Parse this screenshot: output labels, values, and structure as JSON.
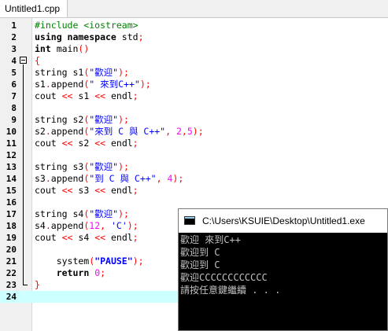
{
  "tab": {
    "label": "Untitled1.cpp"
  },
  "editor": {
    "lines": [
      {
        "num": "1",
        "tokens": [
          {
            "t": "#include <iostream>",
            "c": "pp"
          }
        ]
      },
      {
        "num": "2",
        "tokens": [
          {
            "t": "using namespace",
            "c": "kw"
          },
          {
            "t": " std",
            "c": ""
          },
          {
            "t": ";",
            "c": "sym"
          }
        ]
      },
      {
        "num": "3",
        "tokens": [
          {
            "t": "int",
            "c": "kw"
          },
          {
            "t": " main",
            "c": ""
          },
          {
            "t": "()",
            "c": "sym"
          }
        ]
      },
      {
        "num": "4",
        "tokens": [
          {
            "t": "{",
            "c": "sym"
          }
        ]
      },
      {
        "num": "5",
        "tokens": [
          {
            "t": "string s1",
            "c": ""
          },
          {
            "t": "(",
            "c": "sym"
          },
          {
            "t": "\"歡迎\"",
            "c": "str"
          },
          {
            "t": ");",
            "c": "sym"
          }
        ]
      },
      {
        "num": "6",
        "tokens": [
          {
            "t": "s1",
            "c": ""
          },
          {
            "t": ".",
            "c": "sym"
          },
          {
            "t": "append",
            "c": ""
          },
          {
            "t": "(",
            "c": "sym"
          },
          {
            "t": "\" 來到C++\"",
            "c": "str"
          },
          {
            "t": ");",
            "c": "sym"
          }
        ]
      },
      {
        "num": "7",
        "tokens": [
          {
            "t": "cout ",
            "c": ""
          },
          {
            "t": "<<",
            "c": "sym"
          },
          {
            "t": " s1 ",
            "c": ""
          },
          {
            "t": "<<",
            "c": "sym"
          },
          {
            "t": " endl",
            "c": ""
          },
          {
            "t": ";",
            "c": "sym"
          }
        ]
      },
      {
        "num": "8",
        "tokens": []
      },
      {
        "num": "9",
        "tokens": [
          {
            "t": "string s2",
            "c": ""
          },
          {
            "t": "(",
            "c": "sym"
          },
          {
            "t": "\"歡迎\"",
            "c": "str"
          },
          {
            "t": ");",
            "c": "sym"
          }
        ]
      },
      {
        "num": "10",
        "tokens": [
          {
            "t": "s2",
            "c": ""
          },
          {
            "t": ".",
            "c": "sym"
          },
          {
            "t": "append",
            "c": ""
          },
          {
            "t": "(",
            "c": "sym"
          },
          {
            "t": "\"來到 C 與 C++\"",
            "c": "str"
          },
          {
            "t": ", ",
            "c": "sym"
          },
          {
            "t": "2",
            "c": "num"
          },
          {
            "t": ",",
            "c": "sym"
          },
          {
            "t": "5",
            "c": "num"
          },
          {
            "t": ");",
            "c": "sym"
          }
        ]
      },
      {
        "num": "11",
        "tokens": [
          {
            "t": "cout ",
            "c": ""
          },
          {
            "t": "<<",
            "c": "sym"
          },
          {
            "t": " s2 ",
            "c": ""
          },
          {
            "t": "<<",
            "c": "sym"
          },
          {
            "t": " endl",
            "c": ""
          },
          {
            "t": ";",
            "c": "sym"
          }
        ]
      },
      {
        "num": "12",
        "tokens": []
      },
      {
        "num": "13",
        "tokens": [
          {
            "t": "string s3",
            "c": ""
          },
          {
            "t": "(",
            "c": "sym"
          },
          {
            "t": "\"歡迎\"",
            "c": "str"
          },
          {
            "t": ");",
            "c": "sym"
          }
        ]
      },
      {
        "num": "14",
        "tokens": [
          {
            "t": "s3",
            "c": ""
          },
          {
            "t": ".",
            "c": "sym"
          },
          {
            "t": "append",
            "c": ""
          },
          {
            "t": "(",
            "c": "sym"
          },
          {
            "t": "\"到 C 與 C++\"",
            "c": "str"
          },
          {
            "t": ", ",
            "c": "sym"
          },
          {
            "t": "4",
            "c": "num"
          },
          {
            "t": ");",
            "c": "sym"
          }
        ]
      },
      {
        "num": "15",
        "tokens": [
          {
            "t": "cout ",
            "c": ""
          },
          {
            "t": "<<",
            "c": "sym"
          },
          {
            "t": " s3 ",
            "c": ""
          },
          {
            "t": "<<",
            "c": "sym"
          },
          {
            "t": " endl",
            "c": ""
          },
          {
            "t": ";",
            "c": "sym"
          }
        ]
      },
      {
        "num": "16",
        "tokens": []
      },
      {
        "num": "17",
        "tokens": [
          {
            "t": "string s4",
            "c": ""
          },
          {
            "t": "(",
            "c": "sym"
          },
          {
            "t": "\"歡迎\"",
            "c": "str"
          },
          {
            "t": ");",
            "c": "sym"
          }
        ]
      },
      {
        "num": "18",
        "tokens": [
          {
            "t": "s4",
            "c": ""
          },
          {
            "t": ".",
            "c": "sym"
          },
          {
            "t": "append",
            "c": ""
          },
          {
            "t": "(",
            "c": "sym"
          },
          {
            "t": "12",
            "c": "num"
          },
          {
            "t": ", ",
            "c": "sym"
          },
          {
            "t": "'C'",
            "c": "str"
          },
          {
            "t": ");",
            "c": "sym"
          }
        ]
      },
      {
        "num": "19",
        "tokens": [
          {
            "t": "cout ",
            "c": ""
          },
          {
            "t": "<<",
            "c": "sym"
          },
          {
            "t": " s4 ",
            "c": ""
          },
          {
            "t": "<<",
            "c": "sym"
          },
          {
            "t": " endl",
            "c": ""
          },
          {
            "t": ";",
            "c": "sym"
          }
        ]
      },
      {
        "num": "20",
        "tokens": []
      },
      {
        "num": "21",
        "tokens": [
          {
            "t": "    system",
            "c": ""
          },
          {
            "t": "(",
            "c": "sym"
          },
          {
            "t": "\"PAUSE\"",
            "c": "str kw"
          },
          {
            "t": ");",
            "c": "sym"
          }
        ]
      },
      {
        "num": "22",
        "tokens": [
          {
            "t": "    ",
            "c": ""
          },
          {
            "t": "return",
            "c": "kw"
          },
          {
            "t": " ",
            "c": ""
          },
          {
            "t": "0",
            "c": "num"
          },
          {
            "t": ";",
            "c": "sym"
          }
        ]
      },
      {
        "num": "23",
        "tokens": [
          {
            "t": "}",
            "c": "sym"
          }
        ]
      },
      {
        "num": "24",
        "tokens": []
      }
    ],
    "current_line": "24"
  },
  "console": {
    "title": "C:\\Users\\KSUIE\\Desktop\\Untitled1.exe",
    "output": [
      "歡迎 來到C++",
      "歡迎到 C",
      "歡迎到 C",
      "歡迎CCCCCCCCCCCC",
      "請按任意鍵繼續 . . ."
    ]
  }
}
